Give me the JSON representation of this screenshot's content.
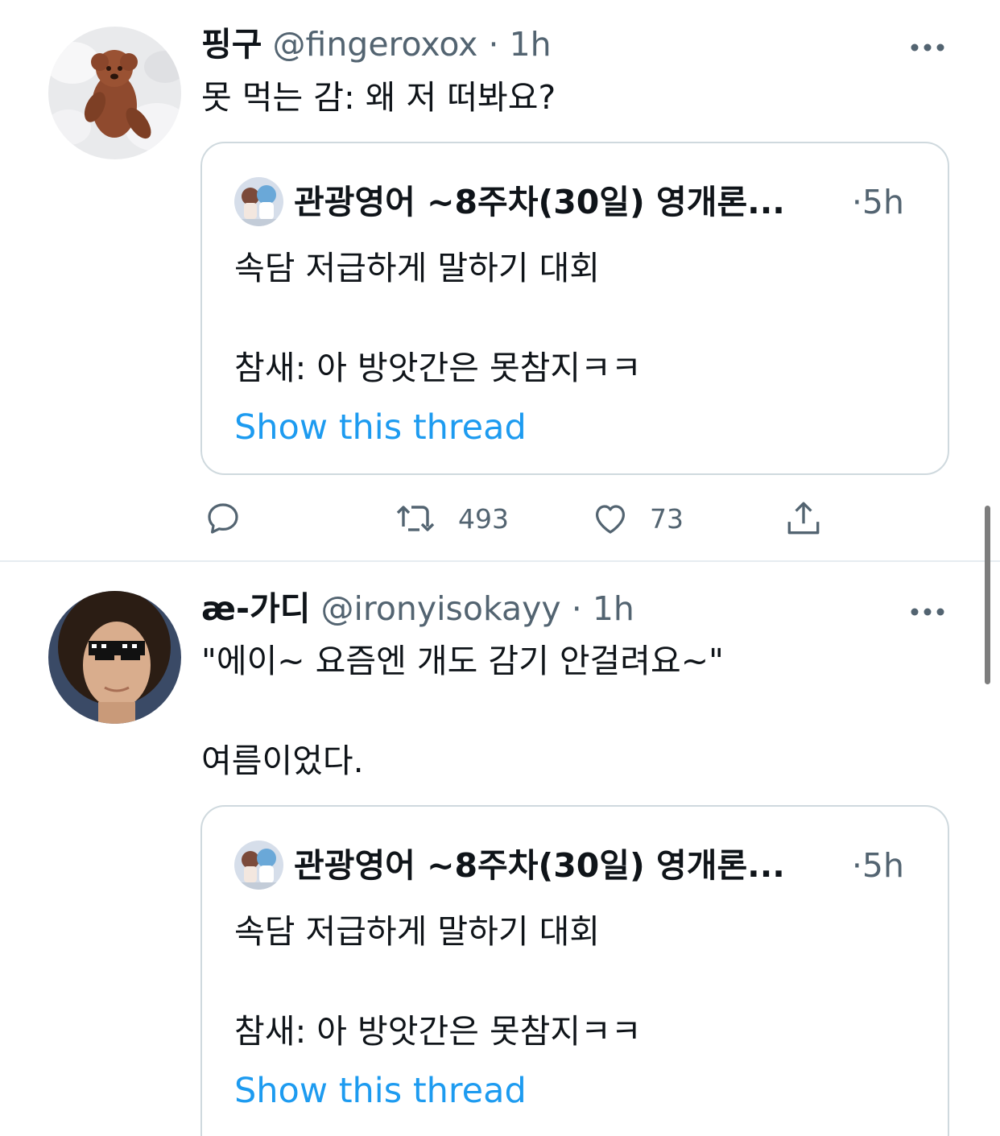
{
  "tweets": [
    {
      "display_name": "핑구",
      "handle": "@fingeroxox",
      "separator": "·",
      "time": "1h",
      "text": "못 먹는 감: 왜 저 떠봐요?",
      "avatar_icon": "poodle-on-bed-avatar",
      "quote": {
        "name": "관광영어 ~8주차(30일) 영개론...",
        "separator": "·",
        "time": "5h",
        "text": "속담 저급하게 말하기 대회\n\n참새: 아 방앗간은 못참지ㅋㅋ",
        "link": "Show this thread"
      },
      "actions": {
        "reply_count": "",
        "retweet_count": "493",
        "like_count": "73"
      }
    },
    {
      "display_name": "æ-가디",
      "handle": "@ironyisokayy",
      "separator": "·",
      "time": "1h",
      "text": "\"에이~ 요즘엔 개도 감기 안걸려요~\"\n\n여름이었다.",
      "avatar_icon": "man-with-pixel-sunglasses-avatar",
      "quote": {
        "name": "관광영어 ~8주차(30일) 영개론...",
        "separator": "·",
        "time": "5h",
        "text": "속담 저급하게 말하기 대회\n\n참새: 아 방앗간은 못참지ㅋㅋ",
        "link": "Show this thread"
      }
    }
  ],
  "colors": {
    "link": "#1d9bf0",
    "secondary_text": "#536471",
    "border": "#cfd9de"
  }
}
